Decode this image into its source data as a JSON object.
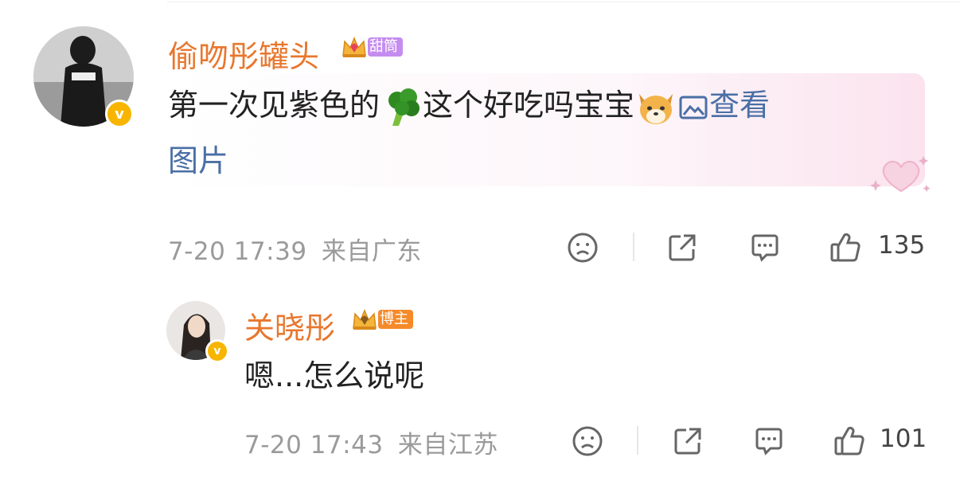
{
  "comment": {
    "username": "偷吻彤罐头",
    "badge_label": "甜筒",
    "text_part1": "第一次见紫色的",
    "emoji_broccoli": "broccoli-emoji",
    "text_part2": "这个好吃吗宝宝",
    "emoji_dog": "doge-emoji",
    "view_image_label": "查看",
    "view_image_label_2": "图片",
    "timestamp": "7-20 17:39",
    "location": "来自广东",
    "like_count": "135"
  },
  "reply": {
    "username": "关晓彤",
    "badge_label": "博主",
    "text": "嗯...怎么说呢",
    "timestamp": "7-20 17:43",
    "location": "来自江苏",
    "like_count": "101"
  },
  "colors": {
    "username": "#e8772e",
    "link": "#4a6fa5",
    "verified": "#f7b500",
    "badge_purple": "#c58cf0",
    "badge_orange": "#f58a2a"
  }
}
